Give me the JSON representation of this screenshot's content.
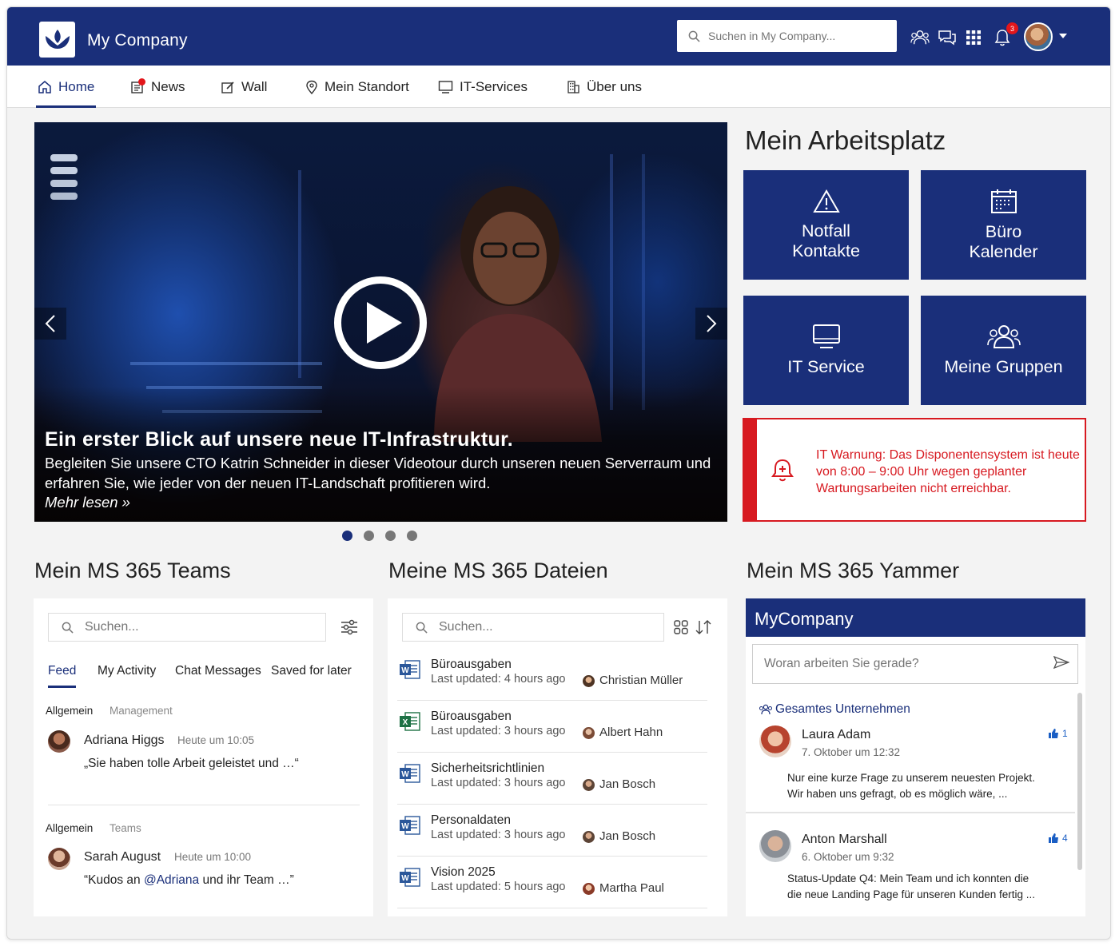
{
  "app": {
    "brand": "My Company",
    "search_placeholder": "Suchen in My Company...",
    "notification_count": "3",
    "accent_color": "#1a2f7a",
    "alert_color": "#d71920"
  },
  "nav": {
    "items": [
      {
        "label": "Home",
        "icon": "home-icon",
        "active": true
      },
      {
        "label": "News",
        "icon": "news-icon"
      },
      {
        "label": "Wall",
        "icon": "edit-icon"
      },
      {
        "label": "Mein Standort",
        "icon": "location-pin-icon"
      },
      {
        "label": "IT-Services",
        "icon": "monitor-icon"
      },
      {
        "label": "Über uns",
        "icon": "building-icon"
      }
    ]
  },
  "hero": {
    "title": "Ein erster Blick auf unsere neue IT-Infrastruktur.",
    "text": "Begleiten Sie unsere CTO Katrin Schneider in dieser Videotour durch unseren neuen Serverraum und erfahren Sie, wie jeder von der neuen IT-Landschaft profitieren wird.",
    "more": "Mehr lesen »",
    "slide_count": 4,
    "active_slide": 1
  },
  "workspace": {
    "title": "Mein Arbeitsplatz",
    "tiles": [
      {
        "line1": "Notfall",
        "line2": "Kontakte",
        "icon": "warning-icon"
      },
      {
        "line1": "Büro",
        "line2": "Kalender",
        "icon": "calendar-icon"
      },
      {
        "line1": "IT Service",
        "line2": "",
        "icon": "monitor-icon"
      },
      {
        "line1": "Meine Gruppen",
        "line2": "",
        "icon": "group-icon"
      }
    ],
    "alert": "IT Warnung: Das Disponentensystem ist heute von 8:00 – 9:00 Uhr wegen geplanter Wartungsarbeiten nicht erreichbar."
  },
  "teams": {
    "title": "Mein MS 365 Teams",
    "search_placeholder": "Suchen...",
    "tabs": [
      "Feed",
      "My Activity",
      "Chat Messages",
      "Saved for later"
    ],
    "posts": [
      {
        "channel": "Allgemein",
        "team": "Management",
        "author": "Adriana Higgs",
        "time": "Heute um 10:05",
        "text_pre": "„Sie haben tolle Arbeit geleistet und …“",
        "mention": "",
        "text_post": ""
      },
      {
        "channel": "Allgemein",
        "team": "Teams",
        "author": "Sarah August",
        "time": "Heute um 10:00",
        "text_pre": "“Kudos an ",
        "mention": "@Adriana",
        "text_post": " und ihr Team …”"
      }
    ]
  },
  "files": {
    "title": "Meine MS 365 Dateien",
    "search_placeholder": "Suchen...",
    "items": [
      {
        "name": "Büroausgaben",
        "updated": "Last updated: 4 hours ago",
        "user": "Christian Müller",
        "type": "word"
      },
      {
        "name": "Büroausgaben",
        "updated": "Last updated: 3 hours ago",
        "user": "Albert Hahn",
        "type": "excel"
      },
      {
        "name": "Sicherheitsrichtlinien",
        "updated": "Last updated: 3 hours ago",
        "user": "Jan Bosch",
        "type": "word"
      },
      {
        "name": "Personaldaten",
        "updated": "Last updated: 3 hours ago",
        "user": "Jan Bosch",
        "type": "word"
      },
      {
        "name": "Vision 2025",
        "updated": "Last updated: 5 hours ago",
        "user": "Martha Paul",
        "type": "word"
      }
    ]
  },
  "yammer": {
    "title": "Mein MS 365 Yammer",
    "network": "MyCompany",
    "input_placeholder": "Woran arbeiten Sie gerade?",
    "group": "Gesamtes Unternehmen",
    "posts": [
      {
        "author": "Laura Adam",
        "time": "7. Oktober um 12:32",
        "likes": "1",
        "text": "Nur eine kurze Frage zu unserem neuesten Projekt. Wir haben uns gefragt, ob es möglich wäre, ..."
      },
      {
        "author": "Anton Marshall",
        "time": "6. Oktober um 9:32",
        "likes": "4",
        "text": "Status-Update Q4: Mein Team und ich konnten die die neue Landing Page für unseren Kunden fertig ..."
      }
    ]
  }
}
